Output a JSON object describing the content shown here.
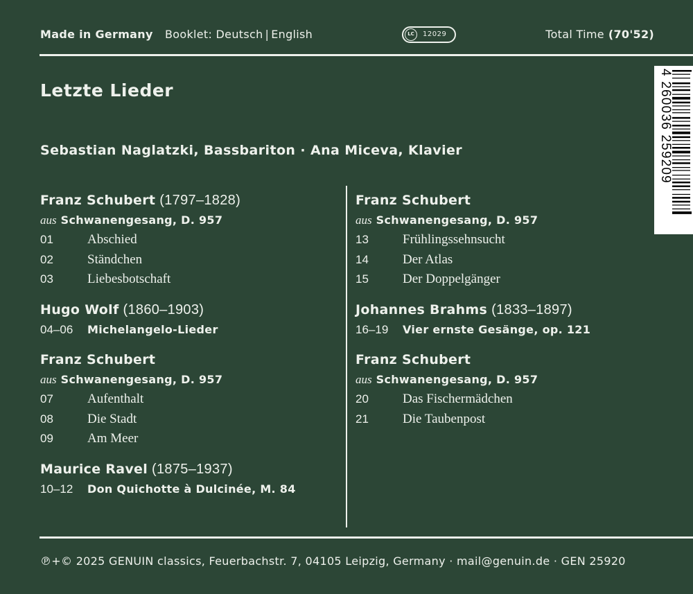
{
  "header": {
    "made_in": "Made in Germany",
    "booklet_label": "Booklet: Deutsch",
    "booklet_sep": "|",
    "booklet_lang2": "English",
    "lc_mark": "LC",
    "lc_number": "12029",
    "total_time_label": "Total Time",
    "total_time_value": "(70'52)"
  },
  "title": "Letzte Lieder",
  "performers": "Sebastian Naglatzki, Bassbariton · Ana Miceva, Klavier",
  "left_column": [
    {
      "composer": "Franz Schubert",
      "dates": "(1797–1828)",
      "aus": "aus",
      "work": "Schwanengesang, D. 957",
      "tracks": [
        {
          "num": "01",
          "title": "Abschied"
        },
        {
          "num": "02",
          "title": "Ständchen"
        },
        {
          "num": "03",
          "title": "Liebesbotschaft"
        }
      ]
    },
    {
      "composer": "Hugo Wolf",
      "dates": "(1860–1903)",
      "tracks": [
        {
          "num": "04–06",
          "title": "Michelangelo-Lieder"
        }
      ]
    },
    {
      "composer": "Franz Schubert",
      "aus": "aus",
      "work": "Schwanengesang, D. 957",
      "tracks": [
        {
          "num": "07",
          "title": "Aufenthalt"
        },
        {
          "num": "08",
          "title": "Die Stadt"
        },
        {
          "num": "09",
          "title": "Am Meer"
        }
      ]
    },
    {
      "composer": "Maurice Ravel",
      "dates": "(1875–1937)",
      "tracks": [
        {
          "num": "10–12",
          "title": "Don Quichotte à Dulcinée, M. 84"
        }
      ]
    }
  ],
  "right_column": [
    {
      "composer": "Franz Schubert",
      "aus": "aus",
      "work": "Schwanengesang, D. 957",
      "tracks": [
        {
          "num": "13",
          "title": "Frühlingssehnsucht"
        },
        {
          "num": "14",
          "title": "Der Atlas"
        },
        {
          "num": "15",
          "title": "Der Doppelgänger"
        }
      ]
    },
    {
      "composer": "Johannes Brahms",
      "dates": "(1833–1897)",
      "tracks": [
        {
          "num": "16–19",
          "title": "Vier ernste Gesänge, op. 121"
        }
      ]
    },
    {
      "composer": "Franz Schubert",
      "aus": "aus",
      "work": "Schwanengesang, D. 957",
      "tracks": [
        {
          "num": "20",
          "title": "Das Fischermädchen"
        },
        {
          "num": "21",
          "title": "Die Taubenpost"
        }
      ]
    }
  ],
  "barcode": {
    "digits": "4 260036 259209"
  },
  "footer": "℗+© 2025 GENUIN classics, Feuerbachstr. 7, 04105 Leipzig, Germany · mail@genuin.de · GEN 25920",
  "colors": {
    "background": "#2c4636",
    "text": "#eef1ec",
    "barcode_bg": "#ffffff",
    "barcode_ink": "#000000"
  }
}
